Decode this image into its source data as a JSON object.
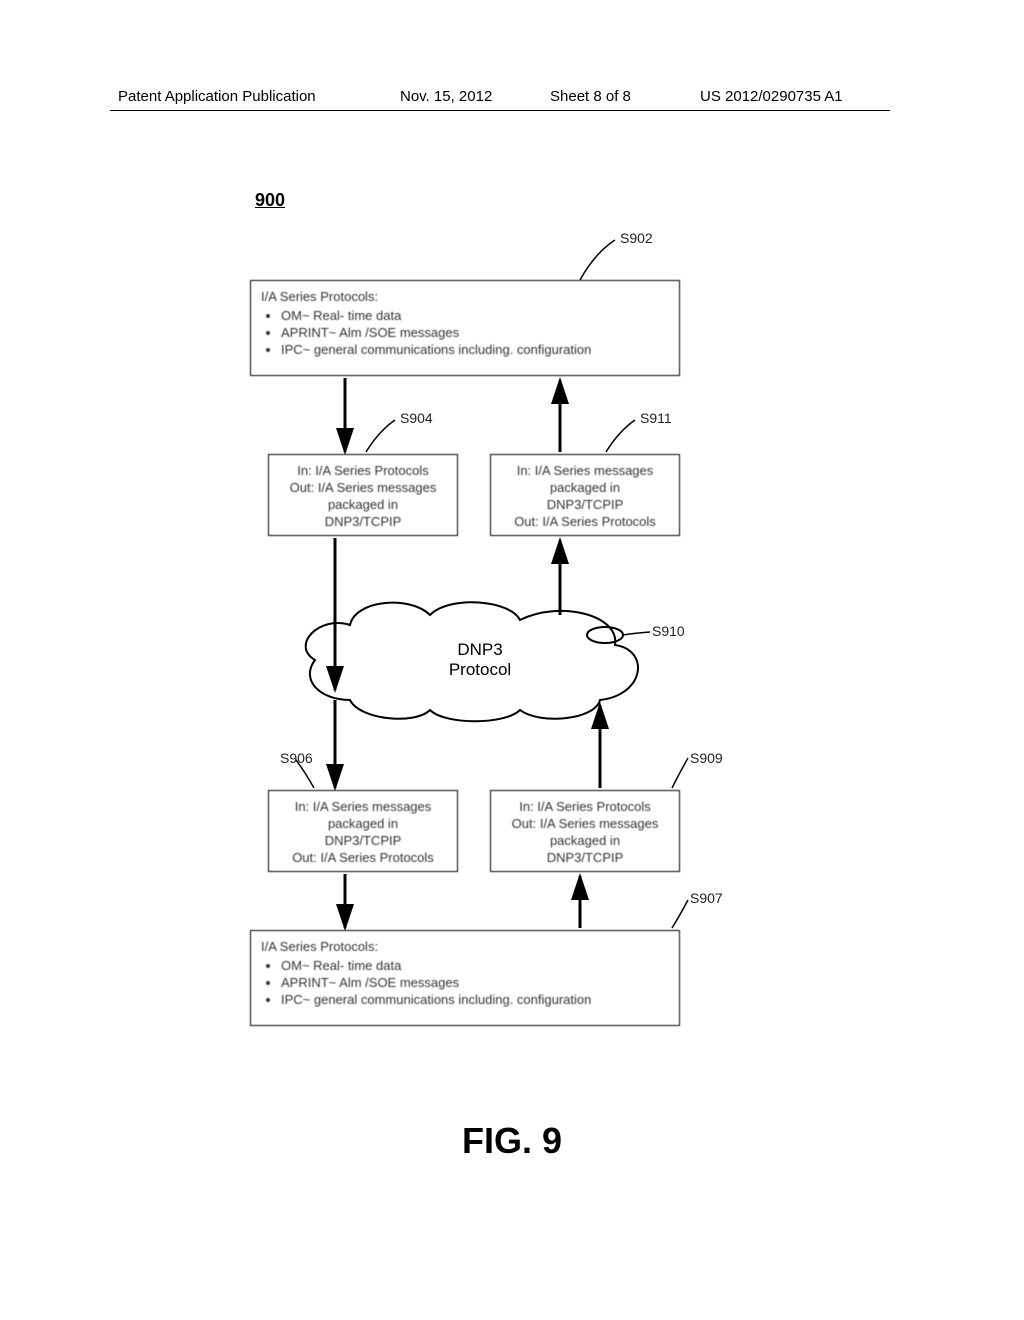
{
  "header": {
    "app_pub": "Patent Application Publication",
    "date": "Nov. 15, 2012",
    "sheet": "Sheet 8 of 8",
    "pubno": "US 2012/0290735 A1"
  },
  "figure_ref": "900",
  "figure_caption": "FIG. 9",
  "callouts": {
    "s902": "S902",
    "s904": "S904",
    "s906": "S906",
    "s907": "S907",
    "s909": "S909",
    "s910": "S910",
    "s911": "S911"
  },
  "box_top": {
    "title": "I/A Series Protocols:",
    "items": [
      "OM~ Real- time data",
      "APRINT~ Alm /SOE messages",
      "IPC~      general communications including. configuration"
    ]
  },
  "box_s904": {
    "l1": "In: I/A Series Protocols",
    "l2": "Out: I/A Series messages",
    "l3": "packaged in",
    "l4": "DNP3/TCPIP"
  },
  "box_s911": {
    "l1": "In: I/A Series messages",
    "l2": "packaged in",
    "l3": "DNP3/TCPIP",
    "l4": "Out: I/A Series Protocols"
  },
  "cloud": {
    "l1": "DNP3",
    "l2": "Protocol"
  },
  "box_s906": {
    "l1": "In: I/A Series messages",
    "l2": "packaged in",
    "l3": "DNP3/TCPIP",
    "l4": "Out: I/A Series Protocols"
  },
  "box_s909": {
    "l1": "In: I/A Series Protocols",
    "l2": "Out: I/A Series messages",
    "l3": "packaged in",
    "l4": "DNP3/TCPIP"
  },
  "box_bottom": {
    "title": "I/A Series Protocols:",
    "items": [
      "OM~ Real- time data",
      "APRINT~ Alm /SOE messages",
      "IPC~      general communications including. configuration"
    ]
  }
}
